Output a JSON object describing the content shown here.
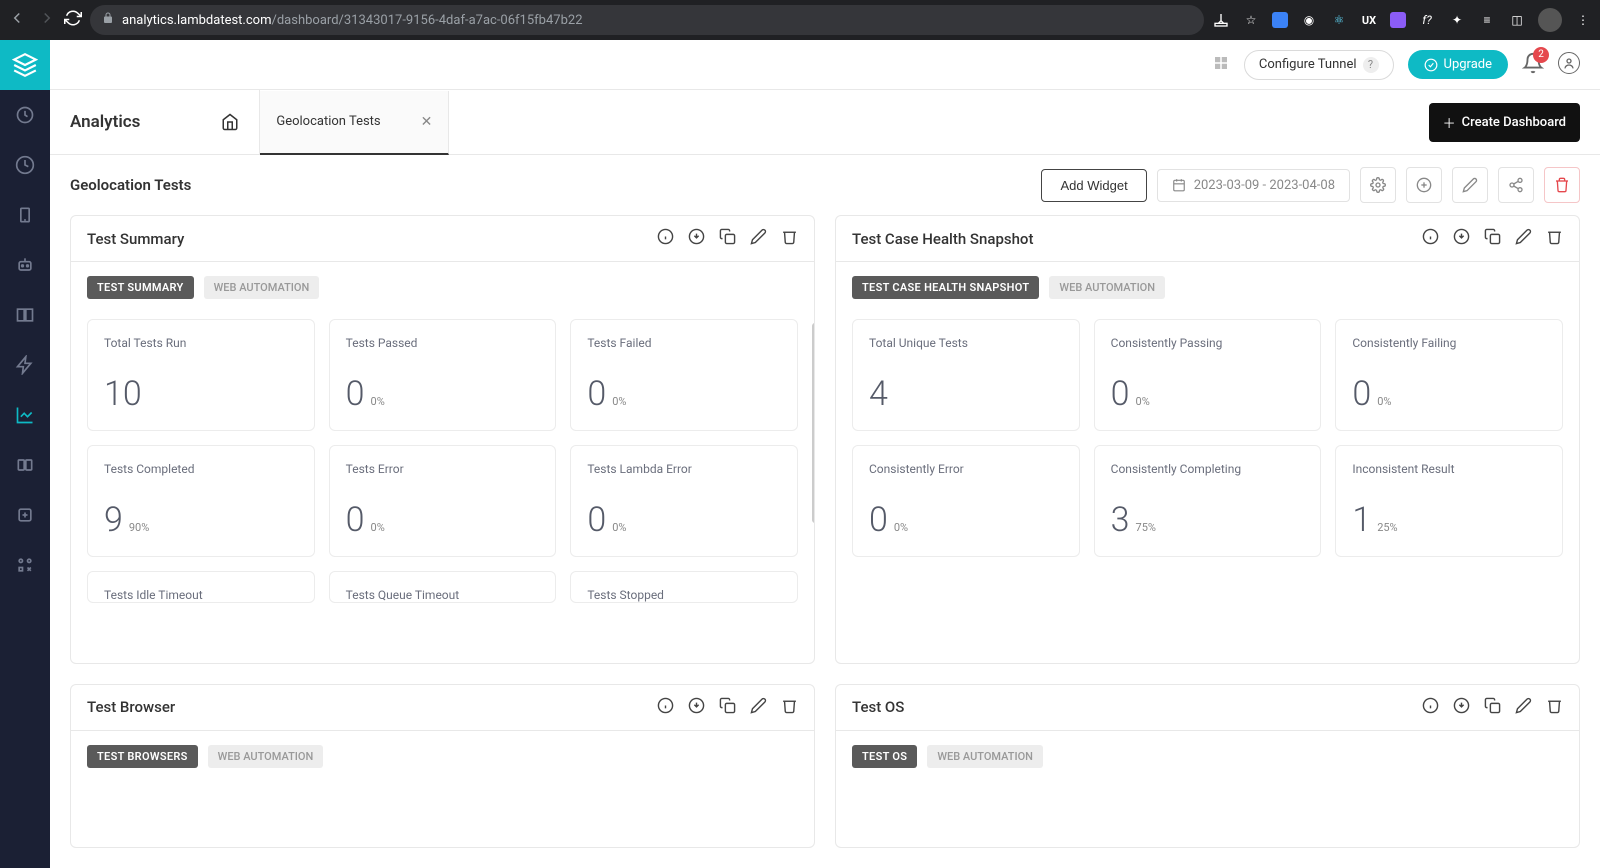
{
  "browser": {
    "url_domain": "analytics.lambdatest.com",
    "url_path": "/dashboard/31343017-9156-4daf-a7ac-06f15fb47b22"
  },
  "topbar": {
    "configure_tunnel": "Configure Tunnel",
    "upgrade": "Upgrade",
    "notifications_count": "2"
  },
  "header": {
    "title": "Analytics",
    "tab_label": "Geolocation Tests",
    "create_dashboard": "Create Dashboard"
  },
  "subheader": {
    "title": "Geolocation Tests",
    "add_widget": "Add Widget",
    "date_range": "2023-03-09 - 2023-04-08"
  },
  "tags": {
    "web_automation": "WEB AUTOMATION"
  },
  "widgets": {
    "test_summary": {
      "title": "Test Summary",
      "badge": "TEST SUMMARY",
      "stats": [
        {
          "label": "Total Tests Run",
          "value": "10",
          "pct": ""
        },
        {
          "label": "Tests Passed",
          "value": "0",
          "pct": "0%"
        },
        {
          "label": "Tests Failed",
          "value": "0",
          "pct": "0%"
        },
        {
          "label": "Tests Completed",
          "value": "9",
          "pct": "90%"
        },
        {
          "label": "Tests Error",
          "value": "0",
          "pct": "0%"
        },
        {
          "label": "Tests Lambda Error",
          "value": "0",
          "pct": "0%"
        },
        {
          "label": "Tests Idle Timeout",
          "value": "",
          "pct": ""
        },
        {
          "label": "Tests Queue Timeout",
          "value": "",
          "pct": ""
        },
        {
          "label": "Tests Stopped",
          "value": "",
          "pct": ""
        }
      ]
    },
    "health_snapshot": {
      "title": "Test Case Health Snapshot",
      "badge": "TEST CASE HEALTH SNAPSHOT",
      "stats": [
        {
          "label": "Total Unique Tests",
          "value": "4",
          "pct": ""
        },
        {
          "label": "Consistently Passing",
          "value": "0",
          "pct": "0%"
        },
        {
          "label": "Consistently Failing",
          "value": "0",
          "pct": "0%"
        },
        {
          "label": "Consistently Error",
          "value": "0",
          "pct": "0%"
        },
        {
          "label": "Consistently Completing",
          "value": "3",
          "pct": "75%"
        },
        {
          "label": "Inconsistent Result",
          "value": "1",
          "pct": "25%"
        }
      ]
    },
    "test_browser": {
      "title": "Test Browser",
      "badge": "TEST BROWSERS"
    },
    "test_os": {
      "title": "Test OS",
      "badge": "TEST OS"
    }
  }
}
